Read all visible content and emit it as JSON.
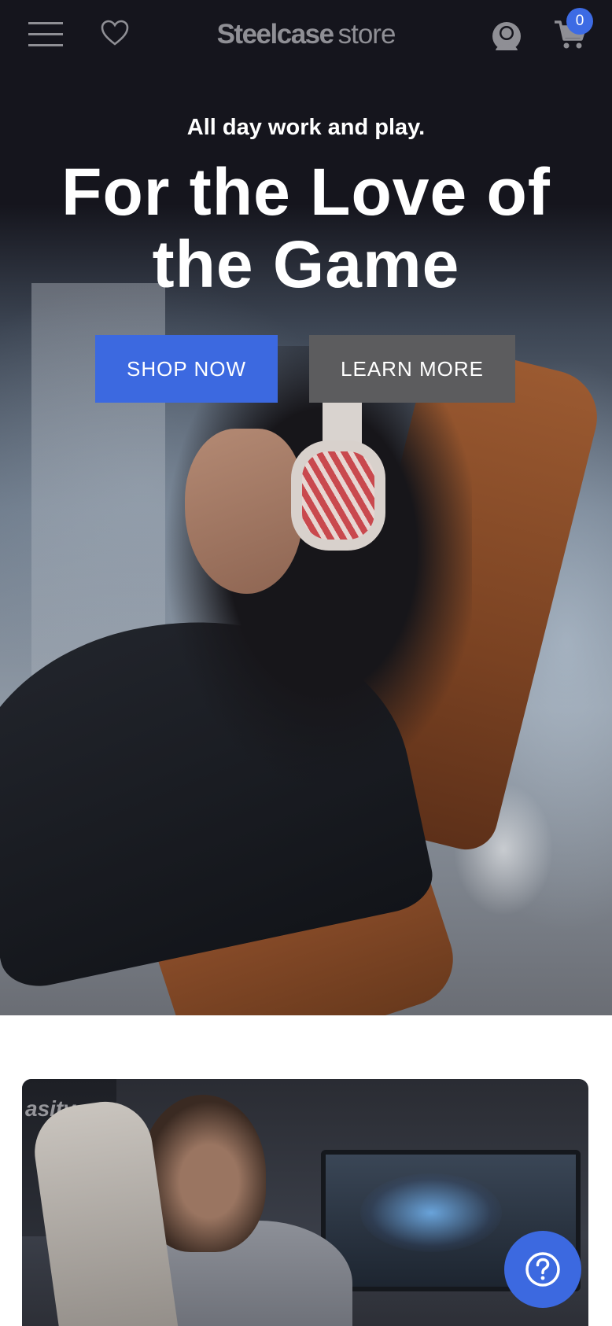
{
  "header": {
    "brand_bold": "Steelcase",
    "brand_light": "store",
    "cart_count": "0",
    "icons": {
      "menu": "hamburger-icon",
      "wishlist": "heart-icon",
      "account": "user-icon",
      "cart": "cart-icon"
    }
  },
  "hero": {
    "eyebrow": "All day work and play.",
    "headline": "For the Love of the Game",
    "primary_cta": "SHOP NOW",
    "secondary_cta": "LEARN MORE"
  },
  "card": {
    "logo_fragment": "asity"
  },
  "help": {
    "icon": "question-icon"
  },
  "colors": {
    "header_bg": "#15151d",
    "accent_blue": "#3c69e0",
    "secondary_button": "#5c5c5e",
    "brand_gray": "#8f8f95",
    "text_white": "#ffffff"
  }
}
